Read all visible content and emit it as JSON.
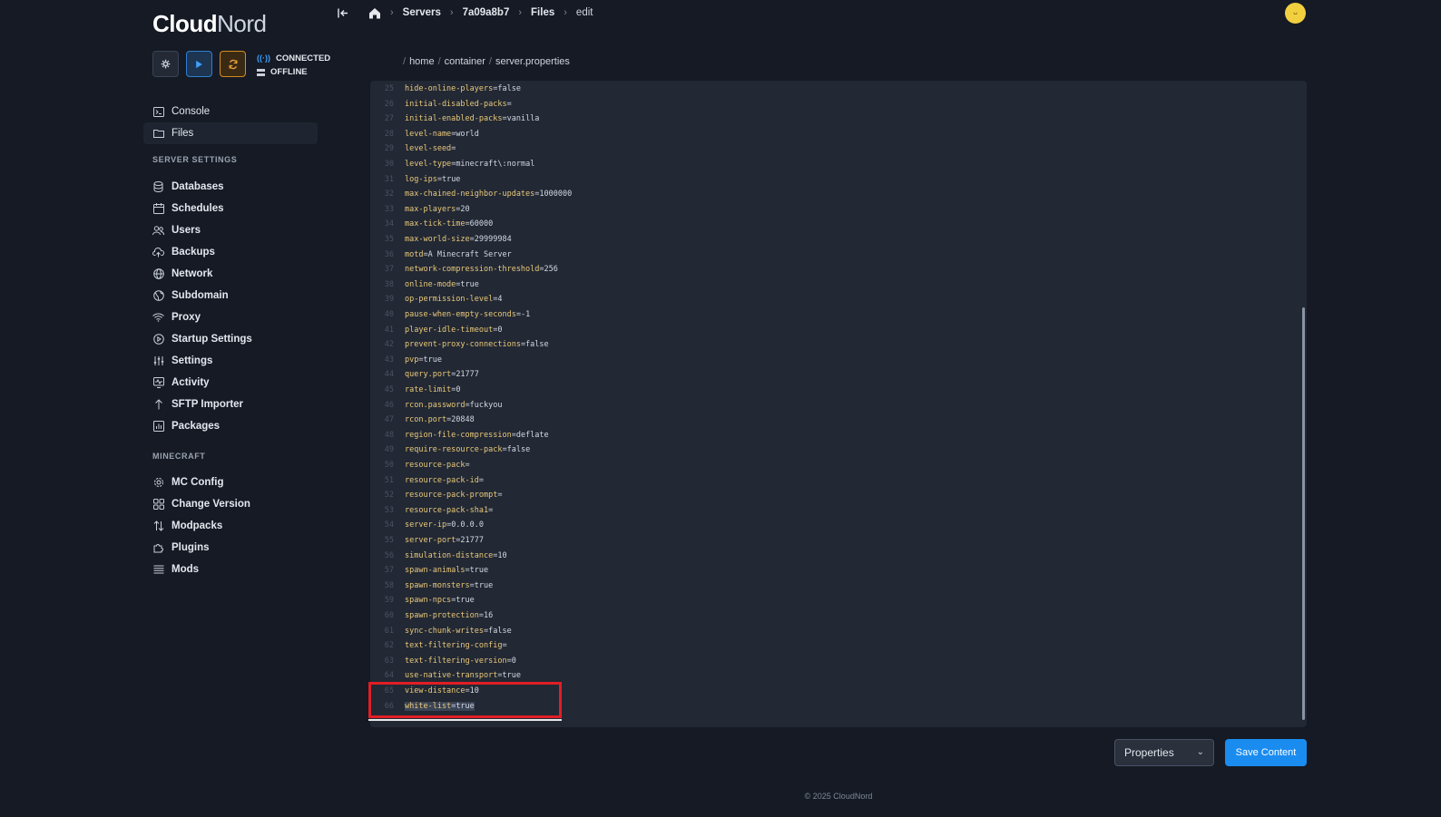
{
  "brand": {
    "part1": "Cloud",
    "part2": "Nord"
  },
  "controls": {
    "status_connected": "CONNECTED",
    "status_offline": "OFFLINE"
  },
  "nav": {
    "console": "Console",
    "files": "Files",
    "section_server": "SERVER SETTINGS",
    "databases": "Databases",
    "schedules": "Schedules",
    "users": "Users",
    "backups": "Backups",
    "network": "Network",
    "subdomain": "Subdomain",
    "proxy": "Proxy",
    "startup": "Startup Settings",
    "settings": "Settings",
    "activity": "Activity",
    "sftp": "SFTP Importer",
    "packages": "Packages",
    "section_minecraft": "MINECRAFT",
    "mcconfig": "MC Config",
    "changeversion": "Change Version",
    "modpacks": "Modpacks",
    "plugins": "Plugins",
    "mods": "Mods"
  },
  "breadcrumb": {
    "servers": "Servers",
    "server_id": "7a09a8b7",
    "files": "Files",
    "edit": "edit"
  },
  "path": {
    "root": "/",
    "p1": "home",
    "p2": "container",
    "p3": "server.properties"
  },
  "editor": {
    "lines": [
      {
        "n": "25",
        "k": "hide-online-players",
        "v": "false"
      },
      {
        "n": "26",
        "k": "initial-disabled-packs",
        "v": ""
      },
      {
        "n": "27",
        "k": "initial-enabled-packs",
        "v": "vanilla"
      },
      {
        "n": "28",
        "k": "level-name",
        "v": "world"
      },
      {
        "n": "29",
        "k": "level-seed",
        "v": ""
      },
      {
        "n": "30",
        "k": "level-type",
        "v": "minecraft\\:normal"
      },
      {
        "n": "31",
        "k": "log-ips",
        "v": "true"
      },
      {
        "n": "32",
        "k": "max-chained-neighbor-updates",
        "v": "1000000"
      },
      {
        "n": "33",
        "k": "max-players",
        "v": "20"
      },
      {
        "n": "34",
        "k": "max-tick-time",
        "v": "60000"
      },
      {
        "n": "35",
        "k": "max-world-size",
        "v": "29999984"
      },
      {
        "n": "36",
        "k": "motd",
        "v": "A Minecraft Server"
      },
      {
        "n": "37",
        "k": "network-compression-threshold",
        "v": "256"
      },
      {
        "n": "38",
        "k": "online-mode",
        "v": "true"
      },
      {
        "n": "39",
        "k": "op-permission-level",
        "v": "4"
      },
      {
        "n": "40",
        "k": "pause-when-empty-seconds",
        "v": "-1"
      },
      {
        "n": "41",
        "k": "player-idle-timeout",
        "v": "0"
      },
      {
        "n": "42",
        "k": "prevent-proxy-connections",
        "v": "false"
      },
      {
        "n": "43",
        "k": "pvp",
        "v": "true"
      },
      {
        "n": "44",
        "k": "query.port",
        "v": "21777"
      },
      {
        "n": "45",
        "k": "rate-limit",
        "v": "0"
      },
      {
        "n": "46",
        "k": "rcon.password",
        "v": "fuckyou"
      },
      {
        "n": "47",
        "k": "rcon.port",
        "v": "20848"
      },
      {
        "n": "48",
        "k": "region-file-compression",
        "v": "deflate"
      },
      {
        "n": "49",
        "k": "require-resource-pack",
        "v": "false"
      },
      {
        "n": "50",
        "k": "resource-pack",
        "v": ""
      },
      {
        "n": "51",
        "k": "resource-pack-id",
        "v": ""
      },
      {
        "n": "52",
        "k": "resource-pack-prompt",
        "v": ""
      },
      {
        "n": "53",
        "k": "resource-pack-sha1",
        "v": ""
      },
      {
        "n": "54",
        "k": "server-ip",
        "v": "0.0.0.0"
      },
      {
        "n": "55",
        "k": "server-port",
        "v": "21777"
      },
      {
        "n": "56",
        "k": "simulation-distance",
        "v": "10"
      },
      {
        "n": "57",
        "k": "spawn-animals",
        "v": "true"
      },
      {
        "n": "58",
        "k": "spawn-monsters",
        "v": "true"
      },
      {
        "n": "59",
        "k": "spawn-npcs",
        "v": "true"
      },
      {
        "n": "60",
        "k": "spawn-protection",
        "v": "16"
      },
      {
        "n": "61",
        "k": "sync-chunk-writes",
        "v": "false"
      },
      {
        "n": "62",
        "k": "text-filtering-config",
        "v": ""
      },
      {
        "n": "63",
        "k": "text-filtering-version",
        "v": "0"
      },
      {
        "n": "64",
        "k": "use-native-transport",
        "v": "true"
      },
      {
        "n": "65",
        "k": "view-distance",
        "v": "10"
      },
      {
        "n": "66",
        "k": "white-list",
        "v": "true"
      }
    ]
  },
  "bottom": {
    "format": "Properties",
    "save": "Save Content"
  },
  "footer": "© 2025 CloudNord"
}
